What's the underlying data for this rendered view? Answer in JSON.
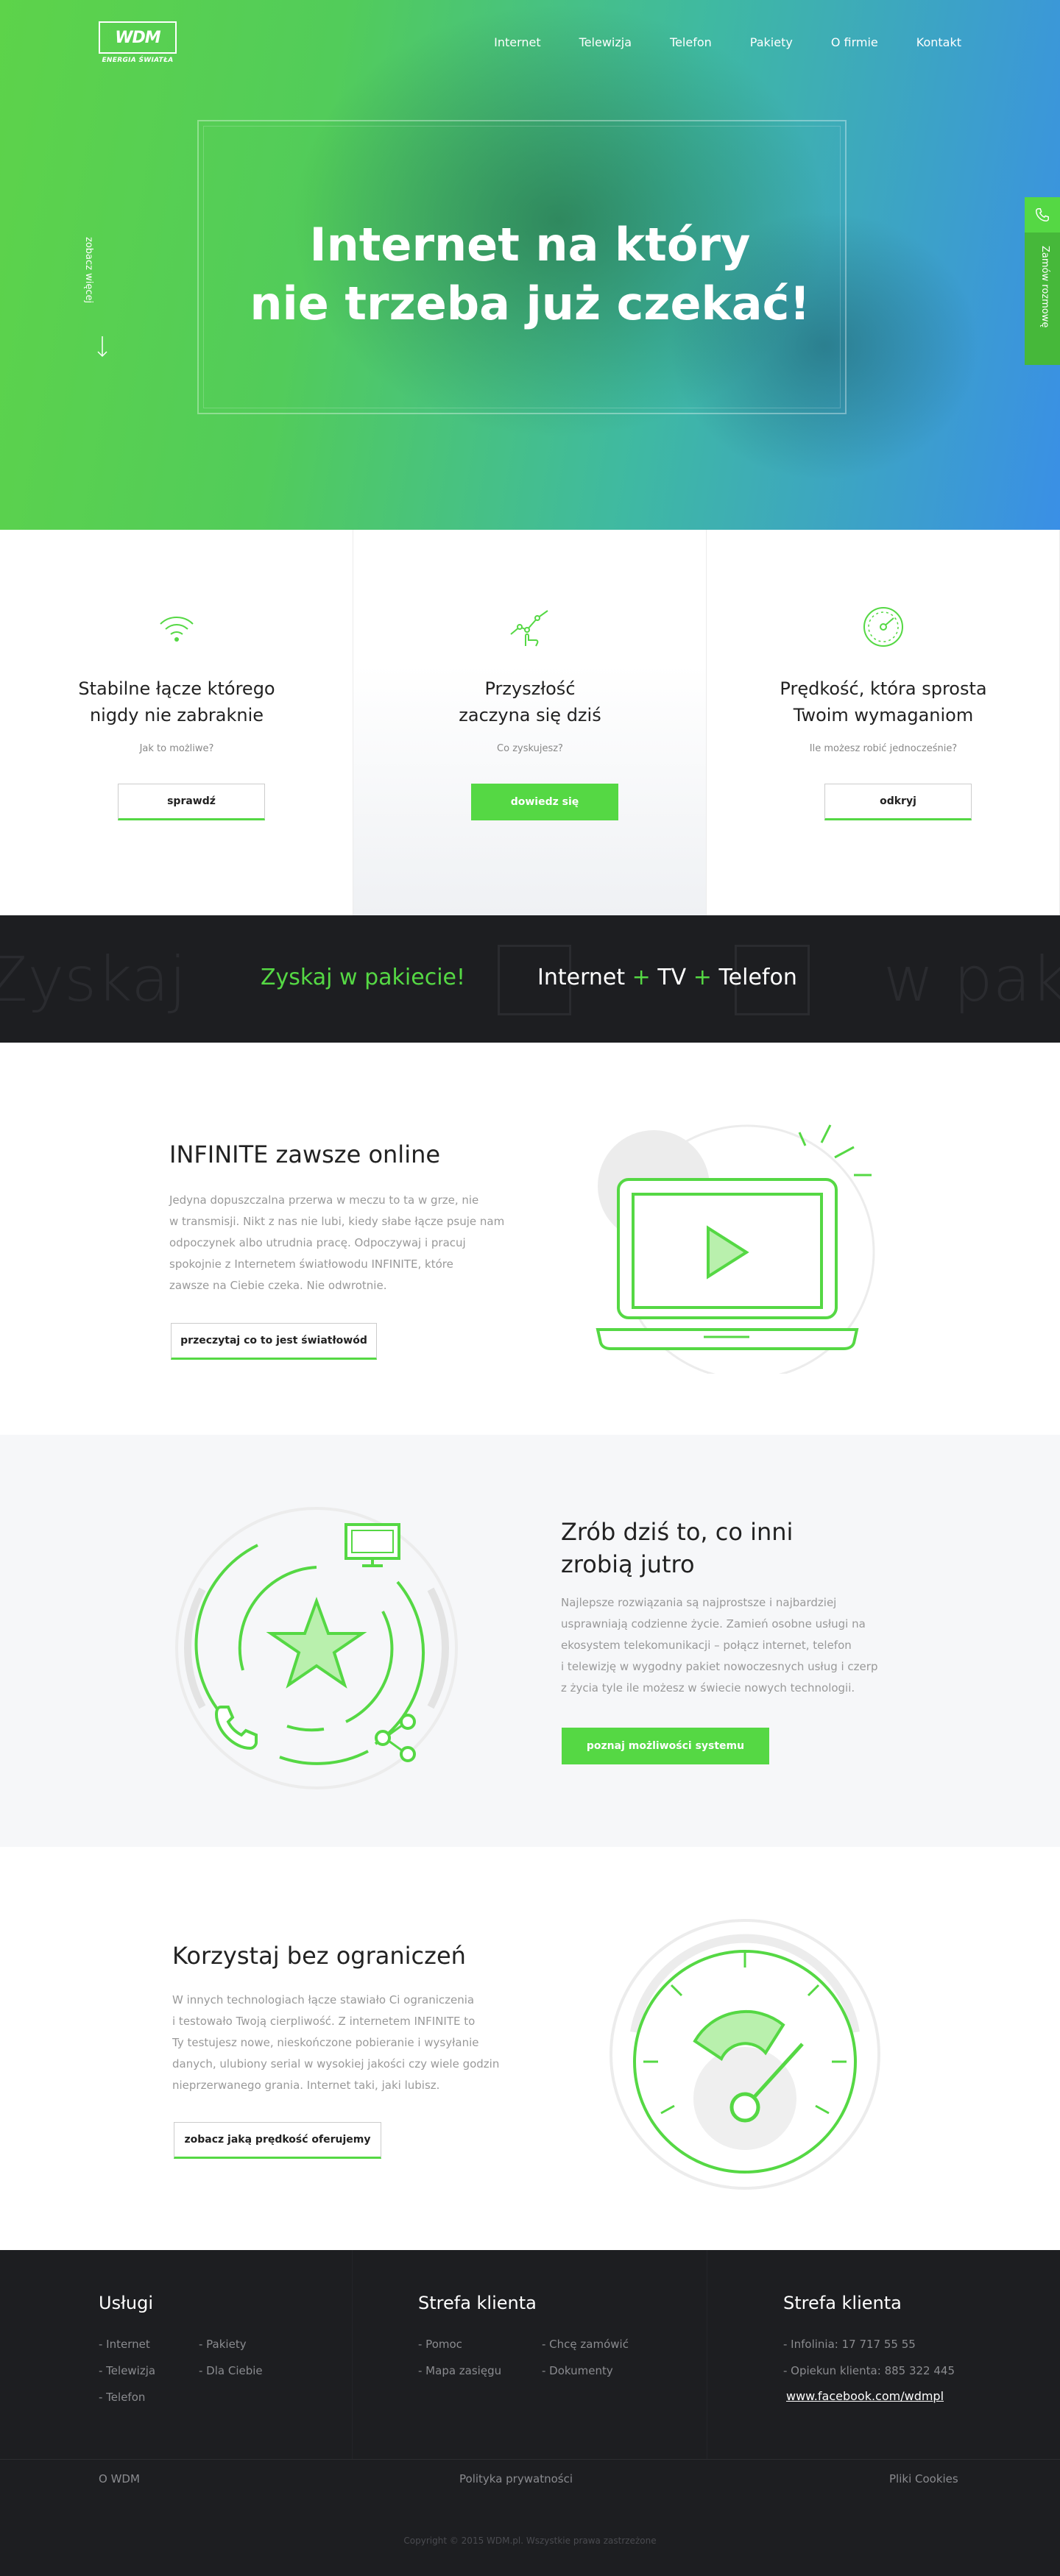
{
  "header": {
    "logo_text": "WDM",
    "logo_tagline": "ENERGIA ŚWIATŁA",
    "nav": [
      "Internet",
      "Telewizja",
      "Telefon",
      "Pakiety",
      "O firmie",
      "Kontakt"
    ]
  },
  "hero": {
    "title_line1": "Internet na który",
    "title_line2": "nie trzeba już czekać!",
    "scroll_hint": "zobacz więcej",
    "side_button": "Zamów rozmowę"
  },
  "features": [
    {
      "icon": "wifi-icon",
      "title_line1": "Stabilne łącze którego",
      "title_line2": "nigdy nie zabraknie",
      "question": "Jak to możliwe?",
      "button": "sprawdź"
    },
    {
      "icon": "growth-chart-icon",
      "title_line1": "Przyszłość",
      "title_line2": "zaczyna się dziś",
      "question": "Co zyskujesz?",
      "button": "dowiedz się"
    },
    {
      "icon": "speedometer-icon",
      "title_line1": "Prędkość, która sprosta",
      "title_line2": "Twoim wymaganiom",
      "question": "Ile możesz robić jednocześnie?",
      "button": "odkryj"
    }
  ],
  "package": {
    "ghost_left": "Zyskaj",
    "ghost_right": "w pakie",
    "lead": "Zyskaj w pakiecie!",
    "item1": "Internet",
    "plus": "+",
    "item2": "TV",
    "item3": "Telefon"
  },
  "section_infinite": {
    "title": "INFINITE zawsze online",
    "lines": [
      "Jedyna dopuszczalna przerwa w meczu to ta w grze, nie",
      "w transmisji. Nikt z nas nie lubi, kiedy słabe łącze psuje nam",
      "odpoczynek albo utrudnia pracę. Odpoczywaj i pracuj",
      "spokojnie z Internetem światłowodu INFINITE, które",
      "zawsze na Ciebie czeka. Nie odwrotnie."
    ],
    "button": "przeczytaj co to jest światłowód"
  },
  "section_today": {
    "title_line1": "Zrób dziś to, co inni",
    "title_line2": "zrobią jutro",
    "lines": [
      "Najlepsze rozwiązania są  najprostsze i najbardziej",
      "usprawniają codzienne życie. Zamień osobne usługi na",
      "ekosystem telekomunikacji – połącz internet, telefon",
      "i telewizję w wygodny pakiet nowoczesnych usług i czerp",
      "z życia tyle ile możesz w świecie nowych technologii."
    ],
    "button": "poznaj możliwości systemu"
  },
  "section_unlimited": {
    "title": "Korzystaj bez ograniczeń",
    "lines": [
      "W innych technologiach łącze stawiało Ci ograniczenia",
      "i testowało Twoją cierpliwość. Z internetem INFINITE to",
      "Ty testujesz nowe, nieskończone pobieranie i wysyłanie",
      "danych, ulubiony serial w wysokiej jakości czy wiele godzin",
      "nieprzerwanego grania. Internet taki, jaki lubisz."
    ],
    "button": "zobacz jaką prędkość oferujemy"
  },
  "footer": {
    "col1_title": "Usługi",
    "col1_a": [
      "- Internet",
      "- Telewizja",
      "- Telefon"
    ],
    "col1_b": [
      "- Pakiety",
      "- Dla Ciebie"
    ],
    "col2_title": "Strefa klienta",
    "col2_a": [
      "- Pomoc",
      "- Mapa zasięgu"
    ],
    "col2_b": [
      "- Chcę zamówić",
      "- Dokumenty"
    ],
    "col3_title": "Strefa klienta",
    "col3": [
      "- Infolinia: 17 717 55 55",
      "- Opiekun klienta: 885 322 445"
    ],
    "facebook": "www.facebook.com/wdmpl",
    "bottom_left": "O WDM",
    "bottom_mid": "Polityka prywatności",
    "bottom_right": "Pliki Cookies",
    "copyright": "Copyright © 2015 WDM.pl. Wszystkie prawa zastrzeżone"
  },
  "colors": {
    "accent": "#55d844",
    "dark": "#1d1e21",
    "hero_blue": "#3a8fe6"
  }
}
